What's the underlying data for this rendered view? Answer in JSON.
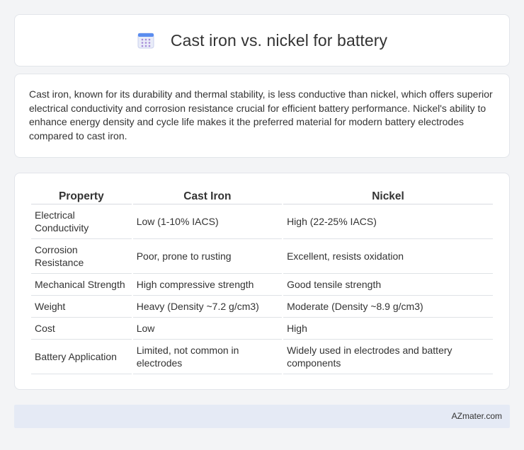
{
  "header": {
    "title": "Cast iron vs. nickel for battery",
    "icon": "calendar-icon",
    "icon_colors": {
      "top": "#5b8def",
      "body": "#e9ecf8",
      "dots": "#a58ad8"
    }
  },
  "summary": {
    "text": "Cast iron, known for its durability and thermal stability, is less conductive than nickel, which offers superior electrical conductivity and corrosion resistance crucial for efficient battery performance. Nickel's ability to enhance energy density and cycle life makes it the preferred material for modern battery electrodes compared to cast iron."
  },
  "table": {
    "headers": [
      "Property",
      "Cast Iron",
      "Nickel"
    ],
    "rows": [
      [
        "Electrical Conductivity",
        "Low (1-10% IACS)",
        "High (22-25% IACS)"
      ],
      [
        "Corrosion Resistance",
        "Poor, prone to rusting",
        "Excellent, resists oxidation"
      ],
      [
        "Mechanical Strength",
        "High compressive strength",
        "Good tensile strength"
      ],
      [
        "Weight",
        "Heavy (Density ~7.2 g/cm3)",
        "Moderate (Density ~8.9 g/cm3)"
      ],
      [
        "Cost",
        "Low",
        "High"
      ],
      [
        "Battery Application",
        "Limited, not common in electrodes",
        "Widely used in electrodes and battery components"
      ]
    ]
  },
  "footer": {
    "brand": "AZmater.com"
  }
}
